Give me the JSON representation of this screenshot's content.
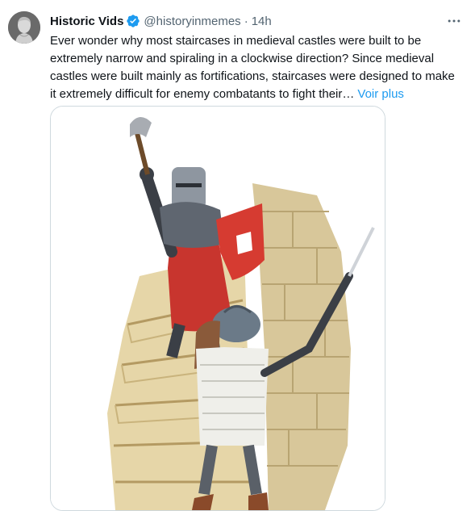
{
  "tweet": {
    "author_name": "Historic Vids",
    "handle": "@historyinmemes",
    "separator": "·",
    "time": "14h",
    "text": "Ever wonder why most staircases in medieval castles were built to be extremely narrow and spiraling in a clockwise direction? Since medieval castles were built mainly as fortifications, staircases were designed to make it extremely difficult for enemy combatants to fight their…",
    "see_more": "Voir plus"
  },
  "icons": {
    "avatar": "bust-portrait-avatar",
    "verified": "verified-badge-icon",
    "more": "more-options-icon"
  },
  "colors": {
    "link": "#1d9bf0",
    "secondary_text": "#536471",
    "verified": "#1d9bf0",
    "border": "#cfd9de"
  }
}
